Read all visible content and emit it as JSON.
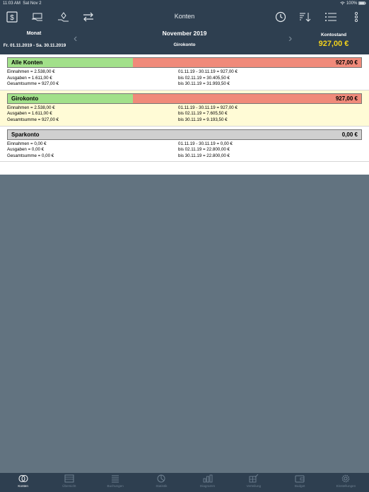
{
  "status": {
    "time": "11:03 AM",
    "date": "Sat Nov 2",
    "battery": "100%"
  },
  "nav": {
    "title": "Konten"
  },
  "header": {
    "monat_label": "Monat",
    "date_range": "Fr. 01.11.2019 - Sa. 30.11.2019",
    "month": "November 2019",
    "account": "Girokonto",
    "kontostand_label": "Kontostand",
    "kontostand_value": "927,00 €"
  },
  "sections": [
    {
      "name": "Alle Konten",
      "total": "927,00 €",
      "income_share": 0.353,
      "left": [
        "Einnahmen = 2.538,00 €",
        "Ausgaben = 1.611,00 €",
        "Gesamtsumme = 927,00 €"
      ],
      "right": [
        "01.11.19 - 30.11.19 = 927,00 €",
        "bis 02.11.19 = 30.405,50 €",
        "bis 30.11.19 = 31.993,50 €"
      ]
    },
    {
      "name": "Girokonto",
      "total": "927,00 €",
      "income_share": 0.353,
      "left": [
        "Einnahmen = 2.538,00 €",
        "Ausgaben = 1.611,00 €",
        "Gesamtsumme = 927,00 €"
      ],
      "right": [
        "01.11.19 - 30.11.19 = 927,00 €",
        "bis 02.11.19 = 7.605,50 €",
        "bis 30.11.19 = 9.193,50 €"
      ]
    },
    {
      "name": "Sparkonto",
      "total": "0,00 €",
      "left": [
        "Einnahmen = 0,00 €",
        "Ausgaben = 0,00 €",
        "Gesamtsumme = 0,00 €"
      ],
      "right": [
        "01.11.19 - 30.11.19 = 0,00 €",
        "bis 02.11.19 = 22.800,00 €",
        "bis 30.11.19 = 22.800,00 €"
      ]
    }
  ],
  "tabs": [
    {
      "label": "Konten",
      "icon": "coins-icon"
    },
    {
      "label": "Übersicht",
      "icon": "overview-icon"
    },
    {
      "label": "Buchungen",
      "icon": "list-icon"
    },
    {
      "label": "Statistik",
      "icon": "pie-icon"
    },
    {
      "label": "Diagramm",
      "icon": "bar-chart-icon"
    },
    {
      "label": "Verteilung",
      "icon": "distribution-icon"
    },
    {
      "label": "Budget",
      "icon": "wallet-icon"
    },
    {
      "label": "Einstellungen",
      "icon": "gear-icon"
    }
  ],
  "colors": {
    "nav_bg": "#2e3f50",
    "income": "#a2e08a",
    "expense": "#f08a7a",
    "balance": "#f2d21c",
    "body_bg": "#627380"
  }
}
